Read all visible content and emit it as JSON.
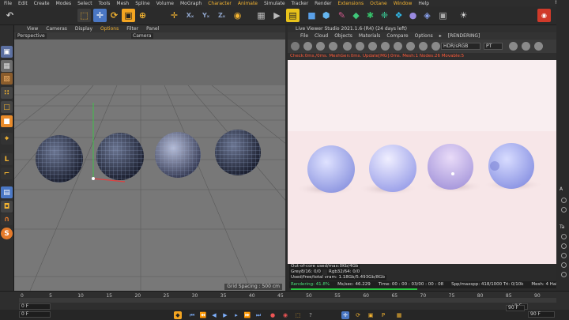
{
  "menu": [
    "File",
    "Edit",
    "Create",
    "Modes",
    "Select",
    "Tools",
    "Mesh",
    "Spline",
    "Volume",
    "MoGraph",
    "Character",
    "Animate",
    "Simulate",
    "Tracker",
    "Render",
    "Extensions",
    "Octane",
    "Window",
    "Help"
  ],
  "menu_highlight": [
    "Character",
    "Animate",
    "Extensions",
    "Octane",
    "Window"
  ],
  "corner_label": "Node",
  "viewport": {
    "menu": [
      "View",
      "Cameras",
      "Display",
      "Options",
      "Filter",
      "Panel"
    ],
    "highlight": "Options",
    "label": "Perspective",
    "camera": "Camera",
    "grid_spacing": "Grid Spacing : 500 cm"
  },
  "live_viewer": {
    "title": "Live Viewer Studio 2021.1.6-(R4) (24 days left)",
    "menu": [
      "File",
      "Cloud",
      "Objects",
      "Materials",
      "Compare",
      "Options",
      "▸",
      "[RENDERING]"
    ],
    "colorspace": "HDR/sRGB",
    "kernel": "PT",
    "status": "Check:0ms./0ms. MeshGen:0ms. Update[MG]:0ms. Mesh:1 Nodes:26 Movable:5",
    "info": {
      "line1": "Out-of-core used/max:0Kb/4Gb",
      "line2a": "Grey8/16: 0/0",
      "line2b": "Rgb32/64: 0/0",
      "line3": "Used/free/total vram: 1.18Gb/5.493Gb/8Gb",
      "stats": [
        "Rendering: 41.8%",
        "Ms/sec: 46.229",
        "Time: 00 : 00 : 03/00 : 00 : 08",
        "Spp/maxspp: 418/1000 Tri: 0/10k",
        "Mesh: 4 Hair: 0",
        "RTXoff",
        "GPU: 69"
      ]
    }
  },
  "timeline": {
    "ticks": [
      "0",
      "5",
      "10",
      "15",
      "20",
      "25",
      "30",
      "35",
      "40",
      "45",
      "50",
      "55",
      "60",
      "65",
      "70",
      "75",
      "80",
      "85",
      "90"
    ],
    "start_field": "0 F",
    "left_field": "0 F",
    "right_field_1": "90 F",
    "right_field_2": "90 F",
    "frame_right": "0 F"
  },
  "attributes": {
    "tab_A": "A",
    "tab_T": "Ta"
  }
}
